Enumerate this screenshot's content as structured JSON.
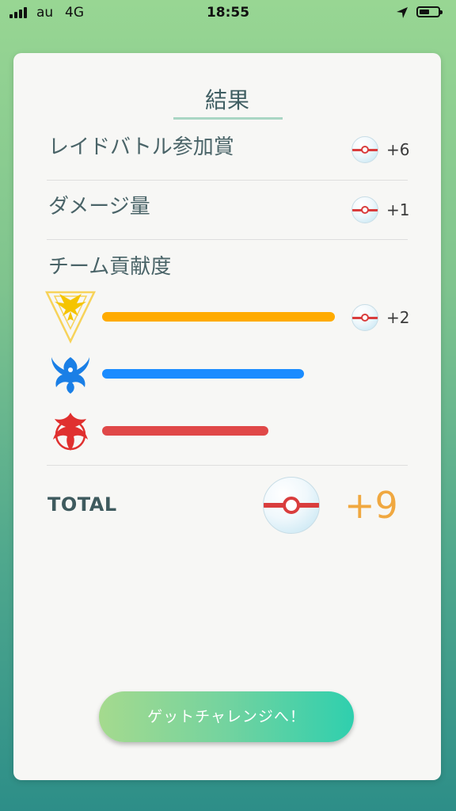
{
  "status_bar": {
    "carrier": "au",
    "network": "4G",
    "time": "18:55",
    "location_icon": "location-arrow-icon",
    "battery_icon": "battery-icon",
    "battery_level": 0.55
  },
  "result": {
    "title": "結果",
    "rows": [
      {
        "label": "レイドバトル参加賞",
        "amount": "+6",
        "icon": "premier-ball-icon"
      },
      {
        "label": "ダメージ量",
        "amount": "+1",
        "icon": "premier-ball-icon"
      }
    ],
    "team_section": {
      "label": "チーム貢献度",
      "teams": [
        {
          "name": "instinct",
          "icon": "team-instinct-icon",
          "color": "#ffab00",
          "contribution": 0.98,
          "amount": "+2"
        },
        {
          "name": "mystic",
          "icon": "team-mystic-icon",
          "color": "#1a8cff",
          "contribution": 0.85,
          "amount": ""
        },
        {
          "name": "valor",
          "icon": "team-valor-icon",
          "color": "#e04848",
          "contribution": 0.7,
          "amount": ""
        }
      ]
    },
    "total": {
      "label": "TOTAL",
      "amount": "+9",
      "icon": "premier-ball-icon"
    }
  },
  "cta": {
    "label": "ゲットチャレンジへ！"
  },
  "colors": {
    "bg_top": "#98d693",
    "bg_bottom": "#2d8e88",
    "total_amount": "#f0a840",
    "cta_start": "#a5da8e",
    "cta_end": "#2fcfae"
  }
}
